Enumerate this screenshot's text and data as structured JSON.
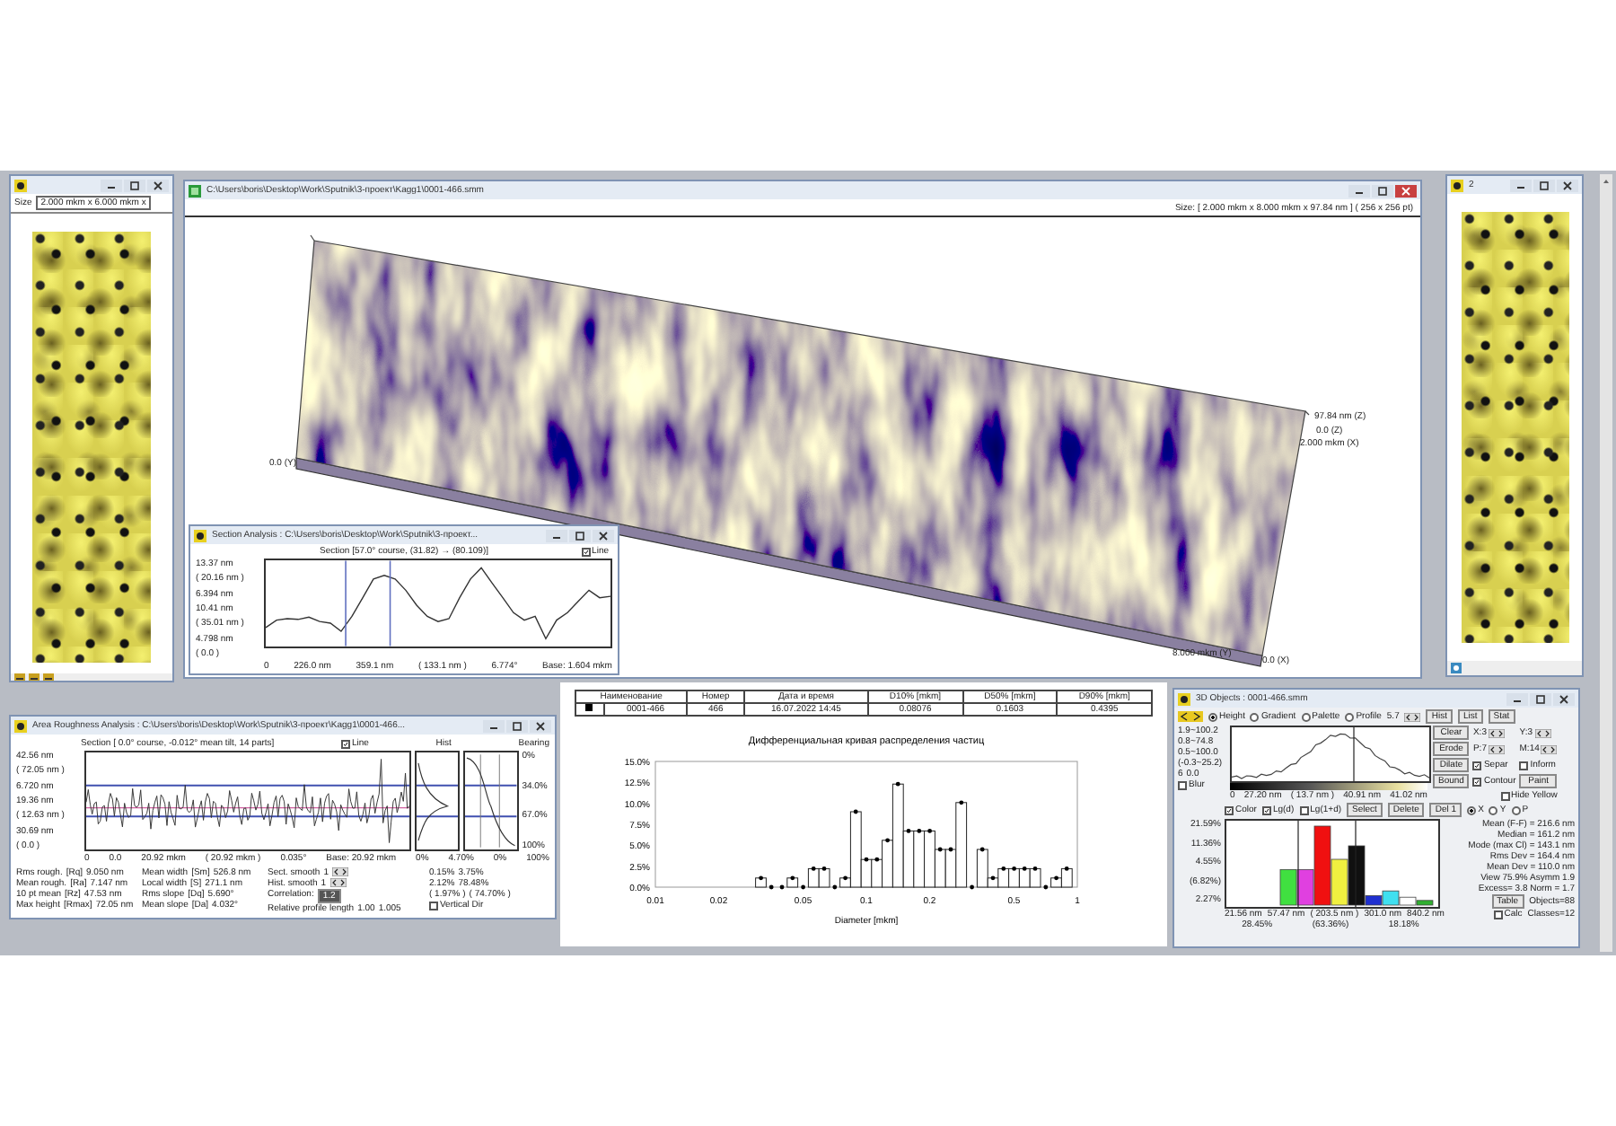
{
  "left_window": {
    "size_label": "Size",
    "size_value": "2.000 mkm x 6.000 mkm x"
  },
  "main_window": {
    "title": "C:\\Users\\boris\\Desktop\\Work\\Sputnik\\3-проект\\Kagg1\\0001-466.smm",
    "size_info": "Size: [ 2.000 mkm x 8.000 mkm x 97.84 nm ] ( 256 x 256 pt)",
    "axis_labels": [
      "0.0 (Y)",
      "97.84 nm (Z)",
      "0.0 (Z)",
      "2.000 mkm (X)",
      "8.000 mkm (Y)",
      "0.0 (X)"
    ]
  },
  "section_window": {
    "title": "Section Analysis : C:\\Users\\boris\\Desktop\\Work\\Sputnik\\3-проект...",
    "section": "Section [57.0° course, (31.82) → (80.109)]",
    "line": {
      "label": "Line",
      "checked": true
    },
    "y_labels": [
      "13.37 nm",
      "( 20.16 nm )",
      "6.394 nm",
      "10.41 nm",
      "( 35.01 nm )",
      "4.798 nm",
      "( 0.0 )"
    ],
    "x_labels": [
      "0",
      "226.0 nm",
      "359.1 nm",
      "( 133.1 nm )",
      "6.774°",
      "Base: 1.604 mkm"
    ]
  },
  "right_window": {
    "title": "2"
  },
  "roughness_window": {
    "title": "Area Roughness Analysis : C:\\Users\\boris\\Desktop\\Work\\Sputnik\\3-проект\\Kagg1\\0001-466...",
    "section": "Section [ 0.0° course, -0.012° mean tilt, 14 parts]",
    "line": {
      "label": "Line",
      "checked": true
    },
    "hist_label": "Hist",
    "bearing_label": "Bearing",
    "y_labels": [
      "42.56 nm",
      "( 72.05 nm )",
      "6.720 nm",
      "19.36 nm",
      "( 12.63 nm )",
      "30.69 nm",
      "( 0.0 )"
    ],
    "right_labels": [
      "0%",
      "34.0%",
      "67.0%",
      "100%"
    ],
    "x_labels": [
      "0",
      "0.0",
      "20.92 mkm",
      "( 20.92 mkm )",
      "0.035°",
      "Base: 20.92 mkm"
    ],
    "hist_x_labels": [
      "0%",
      "4.70%"
    ],
    "bearing_x_labels": [
      "0%",
      "100%"
    ],
    "params": [
      {
        "name": "Rms rough.",
        "symbol": "[Rq]",
        "value": "9.050 nm"
      },
      {
        "name": "Mean rough.",
        "symbol": "[Ra]",
        "value": "7.147 nm"
      },
      {
        "name": "10 pt mean",
        "symbol": "[Rz]",
        "value": "47.53 nm"
      },
      {
        "name": "Max height",
        "symbol": "[Rmax]",
        "value": "72.05 nm"
      }
    ],
    "params2": [
      {
        "name": "Mean width",
        "symbol": "[Sm]",
        "value": "526.8 nm"
      },
      {
        "name": "Local width",
        "symbol": "[S]",
        "value": "271.1 nm"
      },
      {
        "name": "Rms slope",
        "symbol": "[Dq]",
        "value": "5.690°"
      },
      {
        "name": "Mean slope",
        "symbol": "[Da]",
        "value": "4.032°"
      }
    ],
    "smooth": [
      {
        "label": "Sect. smooth",
        "value": "1"
      },
      {
        "label": "Hist. smooth",
        "value": "1"
      }
    ],
    "correlation": {
      "label": "Correlation:",
      "value": "1.2"
    },
    "profile_length": {
      "label": "Relative profile length",
      "values": [
        "1.00",
        "1.005"
      ]
    },
    "stats_columns": [
      [
        "0.15%",
        "2.12%",
        "( 1.97% )"
      ],
      [
        "3.75%",
        "78.48%",
        "( 74.70% )"
      ]
    ],
    "vertical": {
      "label": "Vertical Dir",
      "checked": false
    }
  },
  "particle_table": {
    "columns": [
      "Наименование",
      "Номер",
      "Дата и время",
      "D10% [mkm]",
      "D50% [mkm]",
      "D90% [mkm]"
    ],
    "rows": [
      {
        "selected": true,
        "cells": [
          "0001-466",
          "466",
          "16.07.2022 14:45",
          "0.08076",
          "0.1603",
          "0.4395"
        ]
      }
    ]
  },
  "particle_chart": {
    "chart_data": {
      "type": "bar",
      "title": "Дифференциальная кривая распределения частиц",
      "xlabel": "Diameter [mkm]",
      "categories": [
        "0.01",
        null,
        null,
        null,
        null,
        null,
        "0.02",
        null,
        null,
        null,
        null,
        null,
        null,
        null,
        "0.05",
        null,
        null,
        null,
        null,
        null,
        "0.1",
        null,
        null,
        null,
        null,
        null,
        "0.2",
        null,
        null,
        null,
        null,
        null,
        null,
        null,
        "0.5",
        null,
        null,
        null,
        null,
        null,
        "1"
      ],
      "values": [
        null,
        null,
        null,
        null,
        null,
        null,
        null,
        null,
        null,
        null,
        1.1,
        0,
        0,
        1.1,
        0,
        2.2,
        2.2,
        0,
        1.1,
        9.0,
        3.3,
        3.3,
        5.6,
        12.3,
        6.7,
        6.7,
        6.7,
        4.5,
        4.5,
        10.1,
        0,
        4.5,
        1.1,
        2.2,
        2.2,
        2.2,
        2.2,
        0,
        1.1,
        2.2,
        null
      ],
      "ylim": [
        0,
        15
      ],
      "yticks": [
        {
          "value": 0,
          "label": "0.0%"
        },
        {
          "value": 2.5,
          "label": "2.5%"
        },
        {
          "value": 5,
          "label": "5.0%"
        },
        {
          "value": 7.5,
          "label": "7.5%"
        },
        {
          "value": 10,
          "label": "10.0%"
        },
        {
          "value": 12.5,
          "label": "12.5%"
        },
        {
          "value": 15,
          "label": "15.0%"
        }
      ]
    }
  },
  "objects_window": {
    "title": "3D Objects : 0001-466.smm",
    "modes": [
      {
        "label": "Height",
        "selected": true
      },
      {
        "label": "Gradient",
        "selected": false
      },
      {
        "label": "Palette",
        "selected": false
      },
      {
        "label": "Profile",
        "selected": false
      }
    ],
    "mode_value": "5.7",
    "top_buttons": [
      "Hist",
      "List",
      "Stat"
    ],
    "ranges": [
      "1.9~100.2",
      "0.8~74.8",
      "0.5~100.0",
      "(-0.3~25.2)"
    ],
    "threshold": "6",
    "threshold_value": "0.0",
    "blur": {
      "label": "Blur",
      "checked": false
    },
    "profile_x_labels": [
      "0",
      "27.20 nm",
      "( 13.7 nm )",
      "40.91 nm",
      "41.02 nm"
    ],
    "actions": [
      "Clear",
      "Erode",
      "Dilate",
      "Bound"
    ],
    "spinners": [
      "X:3",
      "Y:3",
      "P:7",
      "M:14"
    ],
    "options": [
      {
        "label": "Separ",
        "checked": true
      },
      {
        "label": "Inform",
        "checked": false
      },
      {
        "label": "Contour",
        "checked": true
      }
    ],
    "paint_button": "Paint",
    "hide_yellow": {
      "label": "Hide Yellow",
      "checked": false
    },
    "hist_options": [
      {
        "label": "Color",
        "checked": true
      },
      {
        "label": "Lg(d)",
        "checked": true
      },
      {
        "label": "Lg(1+d)",
        "checked": false
      }
    ],
    "hist_buttons": [
      "Select",
      "Delete",
      "Del 1"
    ],
    "axis_buttons": [
      {
        "label": "X",
        "selected": true
      },
      {
        "label": "Y",
        "selected": false
      },
      {
        "label": "P",
        "selected": false
      }
    ],
    "y_labels": [
      "21.59%",
      "11.36%",
      "4.55%",
      "(6.82%)",
      "2.27%"
    ],
    "x_labels": [
      "21.56 nm",
      "57.47 nm",
      "( 203.5 nm )",
      "301.0 nm",
      "840.2 nm"
    ],
    "x_sublabels": [
      "28.45%",
      "(63.36%)",
      "18.18%"
    ],
    "stats": [
      "Mean (F-F) = 216.6 nm",
      "Median = 161.2 nm",
      "Mode (max Cl) = 143.1 nm",
      "Rms Dev = 164.4 nm",
      "Mean Dev = 110.0 nm",
      "View 75.9% Asymm 1.9",
      "Excess= 3.8 Norm = 1.7"
    ],
    "table_button": "Table",
    "calc": {
      "label": "Calc",
      "checked": false
    },
    "objects": "Objects=88",
    "classes": "Classes=12"
  }
}
